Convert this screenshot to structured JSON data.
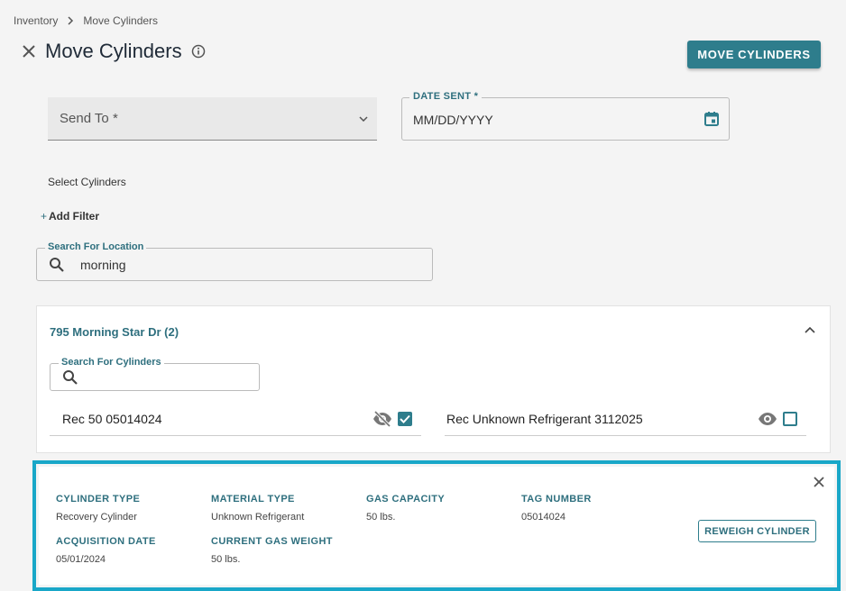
{
  "breadcrumb": {
    "root": "Inventory",
    "current": "Move Cylinders"
  },
  "header": {
    "title": "Move Cylinders",
    "primary_button": "MOVE CYLINDERS"
  },
  "form": {
    "send_to": {
      "placeholder": "Send To *"
    },
    "date_sent": {
      "label": "DATE SENT *",
      "value": "MM/DD/YYYY"
    }
  },
  "section_label": "Select Cylinders",
  "add_filter": {
    "plus": "+",
    "label": "Add Filter"
  },
  "location_search": {
    "label": "Search For Location",
    "value": "morning"
  },
  "location_group": {
    "title": "795 Morning Star Dr (2)",
    "cylinder_search_label": "Search For Cylinders",
    "cylinders": [
      {
        "label": "Rec 50 05014024",
        "visible": false,
        "checked": true
      },
      {
        "label": "Rec Unknown Refrigerant 3112025",
        "visible": true,
        "checked": false
      }
    ]
  },
  "detail": {
    "cylinder_type": {
      "label": "CYLINDER TYPE",
      "value": "Recovery Cylinder"
    },
    "material_type": {
      "label": "MATERIAL TYPE",
      "value": "Unknown Refrigerant"
    },
    "gas_capacity": {
      "label": "GAS CAPACITY",
      "value": "50 lbs."
    },
    "tag_number": {
      "label": "TAG NUMBER",
      "value": "05014024"
    },
    "acquisition_date": {
      "label": "ACQUISITION DATE",
      "value": "05/01/2024"
    },
    "current_gas_weight": {
      "label": "CURRENT GAS WEIGHT",
      "value": "50 lbs."
    },
    "reweigh_button": "REWEIGH CYLINDER"
  },
  "colors": {
    "accent": "#2e7d8c",
    "highlight_border": "#19a7c8"
  }
}
